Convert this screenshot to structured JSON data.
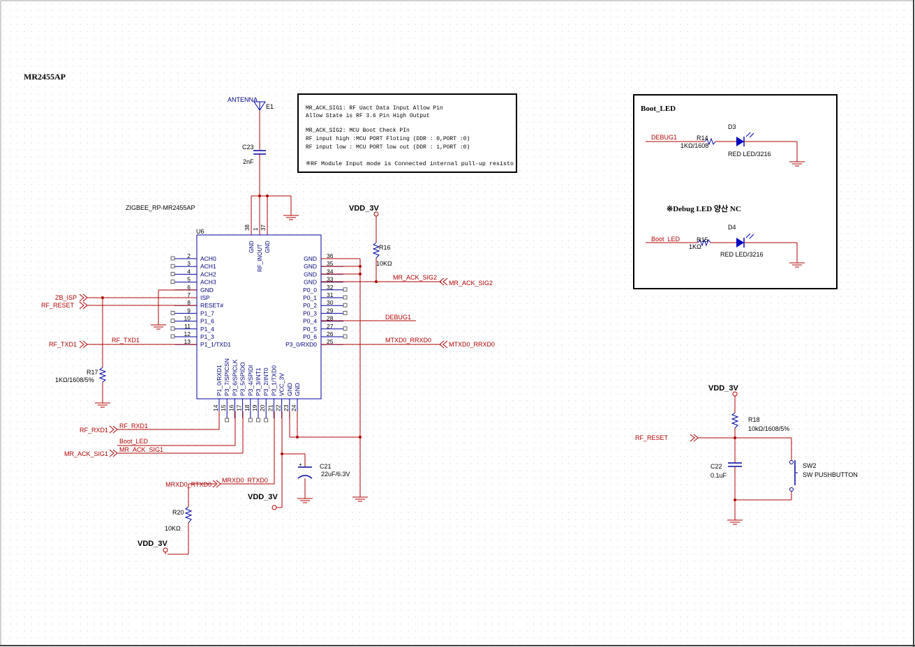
{
  "sheet_title": "MR2455AP",
  "note_box": {
    "lines": [
      "MR_ACK_SIG1: RF Uact Data Input Allow Pin",
      "Allow State is RF 3.6 Pin High Output",
      "MR_ACK_SIG2: MCU Boot Check PIn",
      "RF input high :MCU PORT Floting (DDR : 0,PORT :0)",
      "RF input low :  MCU PORT low out (DDR : 1,PORT :0)",
      "※RF Module Input mode is Connected internal pull-up resisto"
    ]
  },
  "antenna": {
    "label": "ANTENNA",
    "ref": "E1"
  },
  "c23": {
    "ref": "C23",
    "value": "2nF"
  },
  "u6": {
    "part": "ZIGBEE_RP-MR2455AP",
    "ref": "U6",
    "top_pins": [
      {
        "num": "38",
        "name": "GND"
      },
      {
        "num": "1",
        "name": "RF_INOUT"
      },
      {
        "num": "37",
        "name": "GND"
      }
    ],
    "left_pins": [
      {
        "num": "2",
        "name": "ACH0"
      },
      {
        "num": "3",
        "name": "ACH1"
      },
      {
        "num": "4",
        "name": "ACH2"
      },
      {
        "num": "5",
        "name": "ACH3"
      },
      {
        "num": "6",
        "name": "GND"
      },
      {
        "num": "7",
        "name": "ISP"
      },
      {
        "num": "8",
        "name": "RESET#"
      },
      {
        "num": "9",
        "name": "P1_7"
      },
      {
        "num": "10",
        "name": "P1_6"
      },
      {
        "num": "11",
        "name": "P1_4"
      },
      {
        "num": "12",
        "name": "P1_3"
      },
      {
        "num": "13",
        "name": "P1_1/TXD1"
      }
    ],
    "right_pins": [
      {
        "num": "36",
        "name": "GND"
      },
      {
        "num": "35",
        "name": "GND"
      },
      {
        "num": "34",
        "name": "GND"
      },
      {
        "num": "33",
        "name": "GND"
      },
      {
        "num": "32",
        "name": "P0_0"
      },
      {
        "num": "31",
        "name": "P0_1"
      },
      {
        "num": "30",
        "name": "P0_2"
      },
      {
        "num": "29",
        "name": "P0_3"
      },
      {
        "num": "28",
        "name": "P0_4"
      },
      {
        "num": "27",
        "name": "P0_5"
      },
      {
        "num": "26",
        "name": "P0_6"
      },
      {
        "num": "25",
        "name": "P0_7"
      }
    ],
    "right_pin_extra": "P3_0/RXD0",
    "bottom_pins": [
      {
        "num": "14",
        "name": "P1_0/RXD1"
      },
      {
        "num": "15",
        "name": "P3_7/SPICSN"
      },
      {
        "num": "16",
        "name": "P3_6/SPICLK"
      },
      {
        "num": "17",
        "name": "P3_5/SPIDO"
      },
      {
        "num": "18",
        "name": "P3_4/SPIDI"
      },
      {
        "num": "19",
        "name": "P3_3/INT1"
      },
      {
        "num": "20",
        "name": "P3_2/INT0"
      },
      {
        "num": "21",
        "name": "P3_1/TXD0"
      },
      {
        "num": "22",
        "name": "VCC_3V"
      },
      {
        "num": "23",
        "name": "GND"
      },
      {
        "num": "24",
        "name": "GND"
      }
    ]
  },
  "power": {
    "vdd_r16": "VDD_3V",
    "vdd_u6": "VDD_3V",
    "vdd_r20": "VDD_3V",
    "vdd_r18": "VDD_3V"
  },
  "r16": {
    "ref": "R16",
    "value": "10KΩ"
  },
  "r17": {
    "ref": "R17",
    "value": "1KΩ/1608/5%"
  },
  "r20": {
    "ref": "R20",
    "value": "10KΩ"
  },
  "c21": {
    "ref": "C21",
    "value": "22uF/6.3V"
  },
  "ports": {
    "zb_isp": "ZB_ISP",
    "rf_reset": "RF_RESET",
    "rf_txd1": "RF_TXD1",
    "rf_rxd1": "RF_RXD1",
    "mr_ack_sig1": "MR_ACK_SIG1",
    "mrxd0_rtxd0": "MRXD0_RTXD0",
    "mr_ack_sig2": "MR_ACK_SIG2",
    "mtxd0_rrxd0": "MTXD0_RRXD0",
    "rf_reset_2": "RF_RESET"
  },
  "nets": {
    "rf_txd1": "RF_TXD1",
    "rf_rxd1": "RF_RXD1",
    "boot_led": "Boot_LED",
    "mr_ack_sig1": "MR_ACK_SIG1",
    "mrxd0_rtxd0": "MRXD0_RTXD0",
    "mr_ack_sig2": "MR_ACK_SIG2",
    "debug1": "DEBUG1",
    "mtxd0_rrxd0": "MTXD0_RRXD0"
  },
  "boot_led_box": {
    "title": "Boot_LED",
    "note": "※Debug LED 양산 NC",
    "led1": {
      "net": "DEBUG1",
      "r_ref": "R14",
      "r_value": "1KΩ/1608",
      "d_ref": "D3",
      "d_value": "RED LED/3216"
    },
    "led2": {
      "net": "Boot_LED",
      "r_ref": "R15",
      "r_value": "1KΩ",
      "d_ref": "D4",
      "d_value": "RED LED/3216"
    }
  },
  "reset_circuit": {
    "r18": {
      "ref": "R18",
      "value": "10kΩ/1608/5%"
    },
    "c22": {
      "ref": "C22",
      "value": "0.1uF"
    },
    "sw2": {
      "ref": "SW2",
      "value": "SW PUSHBUTTON"
    }
  },
  "colors": {
    "wire": "#b00000",
    "part": "#0000a0",
    "pin_text": "#000080",
    "net_label": "#b00000",
    "grid_dot": "#d0d0d0"
  }
}
